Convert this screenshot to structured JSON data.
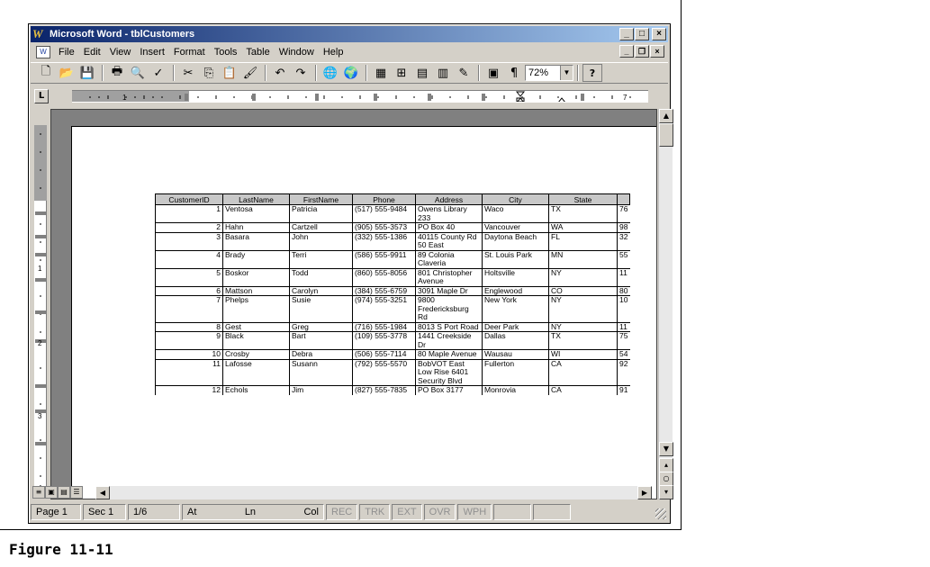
{
  "window": {
    "title": "Microsoft Word - tblCustomers",
    "app_logo": "W"
  },
  "title_buttons": {
    "minimize": "_",
    "maximize": "□",
    "close": "×"
  },
  "menu": {
    "items": [
      "File",
      "Edit",
      "View",
      "Insert",
      "Format",
      "Tools",
      "Table",
      "Window",
      "Help"
    ],
    "doc_buttons": {
      "minimize": "_",
      "restore": "❐",
      "close": "×"
    }
  },
  "toolbar": {
    "icons": [
      "new-document-icon",
      "open-icon",
      "save-icon",
      "print-icon",
      "print-preview-icon",
      "spelling-icon",
      "cut-icon",
      "copy-icon",
      "paste-icon",
      "format-painter-icon",
      "undo-icon",
      "redo-icon",
      "insert-hyperlink-icon",
      "web-toolbar-icon",
      "tables-borders-icon",
      "insert-table-icon",
      "insert-excel-icon",
      "columns-icon",
      "drawing-icon",
      "document-map-icon",
      "show-hide-icon",
      "zoom-icon",
      "help-icon"
    ],
    "zoom": "72%",
    "help": "?"
  },
  "table": {
    "headers": [
      "CustomerID",
      "LastName",
      "FirstName",
      "Phone",
      "Address",
      "City",
      "State",
      ""
    ],
    "rows": [
      [
        "1",
        "Ventosa",
        "Patricia",
        "(517) 555-9484",
        "Owens Library 233",
        "Waco",
        "TX",
        "76"
      ],
      [
        "2",
        "Hahn",
        "Cartzell",
        "(905) 555-3573",
        "PO Box 40",
        "Vancouver",
        "WA",
        "98"
      ],
      [
        "3",
        "Basara",
        "John",
        "(332) 555-1386",
        "40115 County Rd 50 East",
        "Daytona Beach",
        "FL",
        "32"
      ],
      [
        "4",
        "Brady",
        "Terri",
        "(586) 555-9911",
        "89 Colonia Claveria",
        "St. Louis Park",
        "MN",
        "55"
      ],
      [
        "5",
        "Boskor",
        "Todd",
        "(860) 555-8056",
        "801 Christopher Avenue",
        "Holtsville",
        "NY",
        "11"
      ],
      [
        "6",
        "Mattson",
        "Carolyn",
        "(384) 555-6759",
        "3091 Maple Dr",
        "Englewood",
        "CO",
        "80"
      ],
      [
        "7",
        "Phelps",
        "Susie",
        "(974) 555-3251",
        "9800 Fredericksburg Rd",
        "New York",
        "NY",
        "10"
      ],
      [
        "8",
        "Gest",
        "Greg",
        "(716) 555-1984",
        "8013 S Port Road",
        "Deer Park",
        "NY",
        "11"
      ],
      [
        "9",
        "Black",
        "Bart",
        "(109) 555-3778",
        "1441 Creekside Dr",
        "Dallas",
        "TX",
        "75"
      ],
      [
        "10",
        "Crosby",
        "Debra",
        "(506) 555-7114",
        "80 Maple Avenue",
        "Wausau",
        "WI",
        "54"
      ],
      [
        "11",
        "Lafosse",
        "Susann",
        "(792) 555-5570",
        "BobVOT East Low Rise 6401 Security Blvd",
        "Fullerton",
        "CA",
        "92"
      ],
      [
        "12",
        "Echols",
        "Jim",
        "(827) 555-7835",
        "PO Box 3177",
        "Monrovia",
        "CA",
        "91"
      ]
    ]
  },
  "status": {
    "page": "Page 1",
    "sec": "Sec 1",
    "pages": "1/6",
    "at": "At",
    "ln": "Ln",
    "col": "Col",
    "modes": [
      "REC",
      "TRK",
      "EXT",
      "OVR",
      "WPH"
    ]
  },
  "caption": "Figure 11-11"
}
